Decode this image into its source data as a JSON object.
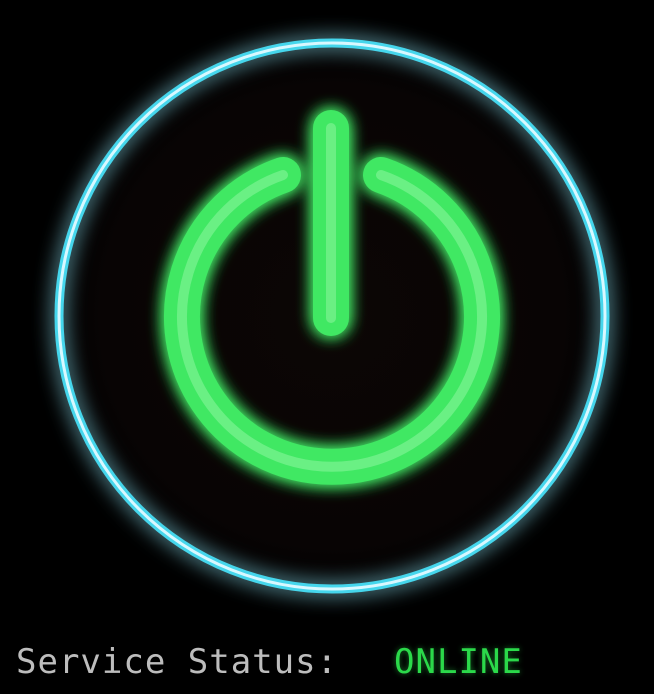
{
  "power_button": {
    "icon": "power-icon",
    "ring_color": "#44d6ec",
    "icon_color": "#3fe864"
  },
  "status": {
    "label": "Service Status:",
    "value": "ONLINE",
    "label_color": "#bdbdbd",
    "value_color": "#2bd94a"
  }
}
